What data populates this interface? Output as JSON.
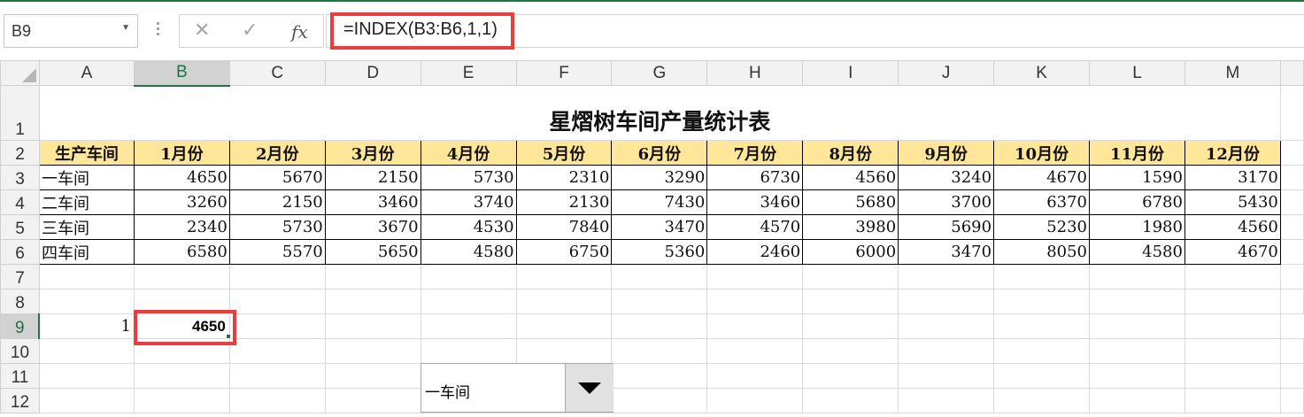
{
  "name_box": "B9",
  "formula_bar": {
    "cancel_icon": "close-icon",
    "enter_icon": "check-icon",
    "fx_label": "fx",
    "formula": "=INDEX(B3:B6,1,1)"
  },
  "columns": [
    "A",
    "B",
    "C",
    "D",
    "E",
    "F",
    "G",
    "H",
    "I",
    "J",
    "K",
    "L",
    "M"
  ],
  "rows": [
    "1",
    "2",
    "3",
    "4",
    "5",
    "6",
    "7",
    "8",
    "9",
    "10",
    "11",
    "12"
  ],
  "sheet": {
    "title": "星熠树车间产量统计表",
    "headers": [
      "生产车间",
      "1月份",
      "2月份",
      "3月份",
      "4月份",
      "5月份",
      "6月份",
      "7月份",
      "8月份",
      "9月份",
      "10月份",
      "11月份",
      "12月份"
    ],
    "data": [
      {
        "label": "一车间",
        "values": [
          "4650",
          "5670",
          "2150",
          "5730",
          "2310",
          "3290",
          "6730",
          "4560",
          "3240",
          "4670",
          "1590",
          "3170"
        ]
      },
      {
        "label": "二车间",
        "values": [
          "3260",
          "2150",
          "3460",
          "3740",
          "2130",
          "7430",
          "3460",
          "5680",
          "3700",
          "6370",
          "6780",
          "5430"
        ]
      },
      {
        "label": "三车间",
        "values": [
          "2340",
          "5730",
          "3670",
          "4530",
          "7840",
          "3470",
          "4570",
          "3980",
          "5690",
          "5230",
          "1980",
          "4560"
        ]
      },
      {
        "label": "四车间",
        "values": [
          "6580",
          "5570",
          "5650",
          "4580",
          "6750",
          "5360",
          "2460",
          "6000",
          "3470",
          "8050",
          "4580",
          "4670"
        ]
      }
    ],
    "a9": "1",
    "b9": "4650"
  },
  "combo": {
    "selected": "一车间",
    "icon": "chevron-down-icon"
  },
  "colors": {
    "accent": "#217346",
    "highlight": "#ea3d3f",
    "header_fill": "#ffe699"
  }
}
